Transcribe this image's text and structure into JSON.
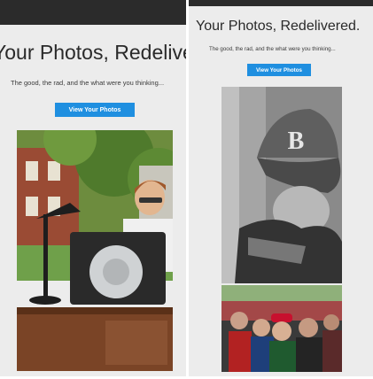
{
  "left_panel": {
    "title": "Your Photos, Redelivered.",
    "tagline": "The good, the rad, and the what were you thinking...",
    "cta_label": "View Your Photos"
  },
  "right_panel": {
    "title": "Your Photos, Redelivered.",
    "tagline": "The good, the rad, and the what were you thinking...",
    "cta_label": "View Your Photos"
  },
  "colors": {
    "cta_background": "#1f8fe0",
    "panel_background": "#ececec",
    "top_bar": "#2b2b2b"
  }
}
